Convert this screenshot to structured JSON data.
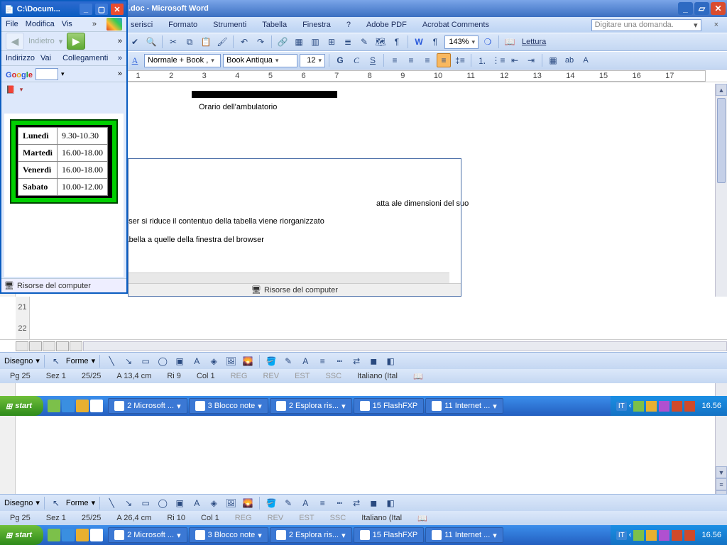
{
  "word": {
    "title_fragment": "agina html.doc - Microsoft Word",
    "menus": [
      "serisci",
      "Formato",
      "Strumenti",
      "Tabella",
      "Finestra",
      "?",
      "Adobe PDF",
      "Acrobat Comments"
    ],
    "ask_placeholder": "Digitare una domanda.",
    "style": "Normale + Book ,",
    "font": "Book Antiqua",
    "size": "12",
    "zoom": "143%",
    "reading": "Lettura",
    "ruler_marks": [
      "2",
      "1",
      "",
      "1",
      "2",
      "3",
      "4",
      "5",
      "6",
      "7",
      "8",
      "9",
      "10",
      "11",
      "12",
      "13",
      "14",
      "15",
      "16",
      "17"
    ],
    "caption": "Orario dell'ambulatorio",
    "body1": "atta ale dimensioni del suo",
    "body2": "o. Se la finestra del browser si riduce il contentuo della tabella viene riorganizzato",
    "body3": "are le dimensioni della tabella a quelle della finestra del browser",
    "embedded_status": "Risorse del computer",
    "draw_label": "Disegno",
    "forme_label": "Forme",
    "status_upper": {
      "pg": "Pg 25",
      "sez": "Sez 1",
      "pages": "25/25",
      "at": "A 13,4 cm",
      "ri": "Ri 9",
      "col": "Col 1",
      "lang": "Italiano (Ital"
    },
    "status_lower": {
      "pg": "Pg 25",
      "sez": "Sez 1",
      "pages": "25/25",
      "at": "A 26,4 cm",
      "ri": "Ri 10",
      "col": "Col 1",
      "lang": "Italiano (Ital"
    },
    "status_dims": [
      "REG",
      "REV",
      "EST",
      "SSC"
    ]
  },
  "ie": {
    "title": "C:\\Docum...",
    "menus": [
      "File",
      "Modifica",
      "Vis"
    ],
    "back": "Indietro",
    "addr_label": "Indirizzo",
    "addr_val": "Vai",
    "links": "Collegamenti",
    "status": "Risorse del computer",
    "schedule": [
      {
        "day": "Lunedì",
        "time": "9.30-10.30"
      },
      {
        "day": "Martedì",
        "time": "16.00-18.00"
      },
      {
        "day": "Venerdì",
        "time": "16.00-18.00"
      },
      {
        "day": "Sabato",
        "time": "10.00-12.00"
      }
    ]
  },
  "taskbar": {
    "start": "start",
    "buttons": [
      "2 Microsoft ...",
      "3 Blocco note",
      "2 Esplora ris...",
      "15 FlashFXP",
      "11 Internet ..."
    ],
    "lang": "IT",
    "clock": "16.56"
  }
}
